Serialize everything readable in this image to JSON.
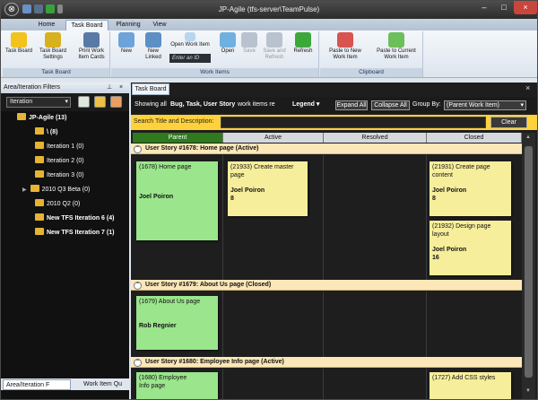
{
  "window": {
    "title": "JP-Agile (tfs-server\\TeamPulse)",
    "logo": "app-logo-icon",
    "controls": [
      "minimize-icon",
      "maximize-icon",
      "close-icon"
    ]
  },
  "ribbon_tabs": [
    "Home",
    "Task Board",
    "Planning",
    "View"
  ],
  "ribbon": {
    "task_board_group": {
      "label": "Task Board",
      "buttons": [
        {
          "label": "Task Board",
          "icon": "sticky-note-icon"
        },
        {
          "label": "Task Board Settings",
          "icon": "settings-note-icon"
        },
        {
          "label": "Print Work Item Cards",
          "icon": "printer-icon"
        }
      ]
    },
    "work_items_group": {
      "label": "Work Items",
      "buttons": [
        {
          "label": "New",
          "icon": "new-item-icon"
        },
        {
          "label": "New Linked",
          "icon": "new-linked-icon"
        },
        {
          "label": "Open Work Item",
          "icon": "open-item-icon"
        },
        {
          "label": "Open",
          "icon": "open-icon"
        },
        {
          "label": "Save",
          "icon": "save-icon"
        },
        {
          "label": "Save and Refresh",
          "icon": "save-refresh-icon"
        },
        {
          "label": "Refresh",
          "icon": "refresh-icon"
        }
      ],
      "enter_id_placeholder": "Enter an ID"
    },
    "clipboard_group": {
      "label": "Clipboard",
      "buttons": [
        {
          "label": "Paste to New Work Item",
          "icon": "paste-new-icon"
        },
        {
          "label": "Paste to Current Work Item",
          "icon": "paste-current-icon"
        }
      ]
    }
  },
  "left_panel": {
    "title": "Area/Iteration Filters",
    "selector": "Iteration",
    "tree": [
      {
        "label": "JP-Agile (13)",
        "bold": true
      },
      {
        "label": "\\ (8)",
        "bold": true
      },
      {
        "label": "Iteration 1 (0)",
        "bold": false
      },
      {
        "label": "Iteration 2 (0)",
        "bold": false
      },
      {
        "label": "Iteration 3 (0)",
        "bold": false
      },
      {
        "label": "2010 Q3 Beta (0)",
        "bold": false
      },
      {
        "label": "2010 Q2 (0)",
        "bold": false
      },
      {
        "label": "New TFS Iteration 6 (4)",
        "bold": true
      },
      {
        "label": "New TFS Iteration 7 (1)",
        "bold": true
      }
    ],
    "tabs": [
      "Area/Iteration F",
      "Work Item Qu"
    ]
  },
  "main": {
    "tab": "Task Board",
    "filter": {
      "prefix": "Showing all",
      "types": "Bug, Task, User Story",
      "suffix": "work items re",
      "legend": "Legend",
      "expand": "Expand All",
      "collapse": "Collapse All",
      "group_by_label": "Group By:",
      "group_by_value": "(Parent Work Item)"
    },
    "search": {
      "label": "Search Title and Description:",
      "value": "",
      "clear": "Clear"
    },
    "columns": [
      "Parent",
      "Active",
      "Resolved",
      "Closed"
    ],
    "stories": [
      {
        "title": "User Story #1678: Home page (Active)",
        "parent": {
          "id": "(1678) Home page",
          "who": "Joel Poiron"
        },
        "active": [
          {
            "id": "(21933) Create master page",
            "who": "Joel Poiron",
            "est": "8"
          }
        ],
        "closed": [
          {
            "id": "(21931) Create page content",
            "who": "Joel Poiron",
            "est": "8"
          },
          {
            "id": "(21932) Design page layout",
            "who": "Joel Poiron",
            "est": "16"
          }
        ]
      },
      {
        "title": "User Story #1679: About Us page (Closed)",
        "parent": {
          "id": "(1679) About Us page",
          "who": "Rob Regnier"
        }
      },
      {
        "title": "User Story #1680: Employee Info page (Active)",
        "parent": {
          "id": "(1680) Employee Info page",
          "who": ""
        },
        "closed": [
          {
            "id": "(1727) Add CSS styles",
            "who": "",
            "est": ""
          }
        ]
      }
    ]
  }
}
